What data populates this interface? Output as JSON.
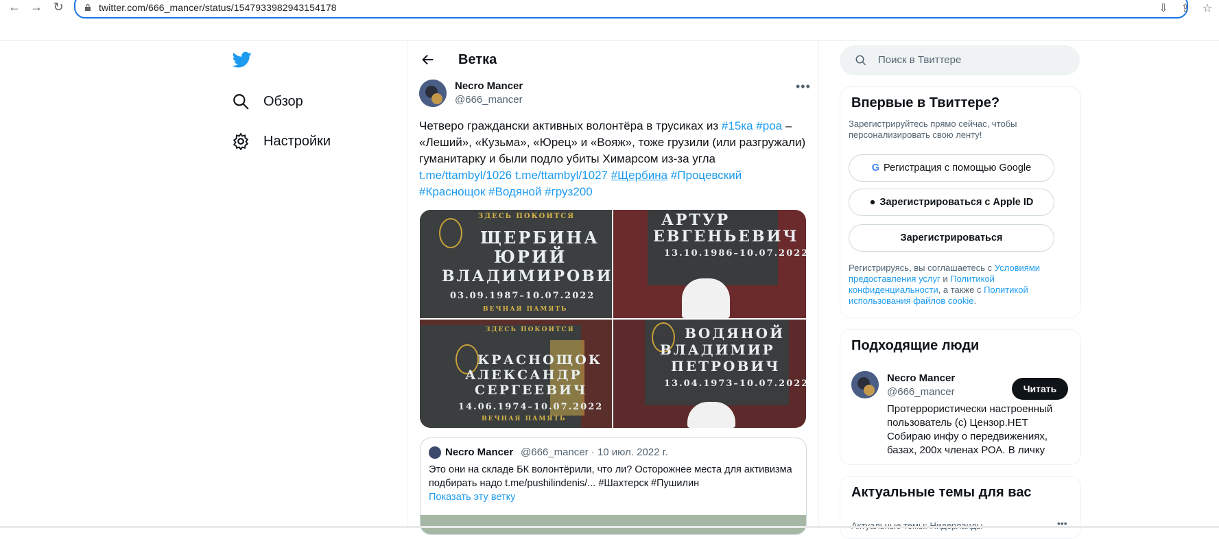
{
  "browser": {
    "url": "twitter.com/666_mancer/status/1547933982943154178",
    "back_icon": "arrow-left-icon",
    "forward_icon": "arrow-right-icon",
    "reload_icon": "reload-icon"
  },
  "nav": {
    "items": [
      {
        "label": "Обзор",
        "icon": "hash-search-icon"
      },
      {
        "label": "Настройки",
        "icon": "gear-icon"
      }
    ]
  },
  "thread": {
    "title": "Ветка",
    "author_name": "Necro Mancer",
    "author_handle": "@666_mancer",
    "text_parts": {
      "p1": "Четверо граждански активных волонтёра в трусиках из ",
      "tag_15ka": "#15ка",
      "tag_roa": "#роа",
      "p2": " – «Леший», «Кузьма», «Юрец» и «Вояж», тоже грузили (или разгружали) гуманитарку и были подло убиты Химарсом из-за угла",
      "link1": "t.me/ttambyl/1026",
      "link2": "t.me/ttambyl/1027",
      "tag_shcherbina": "#Щербина",
      "tag_procevsky": "#Процевский",
      "tag_krasnoshchok": "#Краснощок",
      "tag_vodyanoy": "#Водяной",
      "tag_gruz": "#груз200"
    },
    "photos": [
      {
        "top_small": "ЗДЕСЬ ПОКОИТСЯ",
        "lines": [
          "ЩЕРБИНА",
          "ЮРИЙ",
          "ВЛАДИМИРОВИЧ"
        ],
        "dates": "03.09.1987–10.07.2022",
        "bottom_small": "ВЕЧНАЯ ПАМЯТЬ"
      },
      {
        "lines": [
          "АРТУР",
          "ЕВГЕНЬЕВИЧ"
        ],
        "dates": "13.10.1986–10.07.2022"
      },
      {
        "top_small": "ЗДЕСЬ ПОКОИТСЯ",
        "lines": [
          "КРАСНОЩОК",
          "АЛЕКСАНДР",
          "СЕРГЕЕВИЧ"
        ],
        "dates": "14.06.1974–10.07.2022",
        "bottom_small": "ВЕЧНАЯ ПАМЯТЬ"
      },
      {
        "lines": [
          "ВОДЯНОЙ",
          "ВЛАДИМИР",
          "ПЕТРОВИЧ"
        ],
        "dates": "13.04.1973–10.07.2022"
      }
    ],
    "quote": {
      "name": "Necro Mancer",
      "meta": "@666_mancer · 10 июл. 2022 г.",
      "text": "Это они на складе БК волонтёрили, что ли? Осторожнее места для активизма подбирать надо t.me/pushilindenis/... #Шахтерск #Пушилин",
      "show_thread": "Показать эту ветку"
    }
  },
  "sidebar": {
    "search_placeholder": "Поиск в Твиттере",
    "signup": {
      "title": "Впервые в Твиттере?",
      "subtitle": "Зарегистрируйтесь прямо сейчас, чтобы персонализировать свою ленту!",
      "google": "Регистрация с помощью Google",
      "apple": "Зарегистрироваться с Apple ID",
      "plain": "Зарегистрироваться",
      "terms_1": "Регистрируясь, вы соглашаетесь с ",
      "terms_link1": "Условиями предоставления услуг",
      "terms_2": " и ",
      "terms_link2": "Политикой конфиденциальности",
      "terms_3": ", а также с ",
      "terms_link3": "Политикой использования файлов cookie",
      "terms_4": "."
    },
    "who_to_follow": {
      "title": "Подходящие люди",
      "name": "Necro Mancer",
      "handle": "@666_mancer",
      "follow": "Читать",
      "bio": "Протеррористически настроенный пользователь (с) Цензор.НЕТ Собираю инфу о передвижениях, базах, 200х членах РОА. В личку"
    },
    "trends": {
      "title": "Актуальные темы для вас",
      "sub": "Актуальные темы: Нидерланды"
    }
  },
  "colors": {
    "accent": "#1d9bf0",
    "text": "#0f1419",
    "muted": "#536471"
  }
}
